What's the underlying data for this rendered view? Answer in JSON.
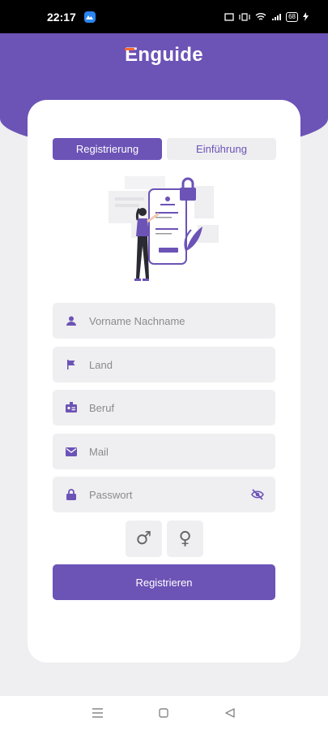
{
  "status_bar": {
    "time": "22:17",
    "battery": "68"
  },
  "app": {
    "logo_text": "Enguide",
    "brand_color": "#6c53b6",
    "accent_color": "#ff6a2e"
  },
  "tabs": [
    {
      "label": "Registrierung",
      "active": true
    },
    {
      "label": "Einführung",
      "active": false
    }
  ],
  "form": {
    "name_placeholder": "Vorname Nachname",
    "country_placeholder": "Land",
    "job_placeholder": "Beruf",
    "mail_placeholder": "Mail",
    "password_placeholder": "Passwort",
    "gender_male": "♂",
    "gender_female": "♀",
    "submit_label": "Registrieren"
  },
  "icons": {
    "name": "person-icon",
    "country": "flag-icon",
    "job": "badge-icon",
    "mail": "mail-icon",
    "password": "lock-icon",
    "visibility": "eye-off-icon"
  }
}
